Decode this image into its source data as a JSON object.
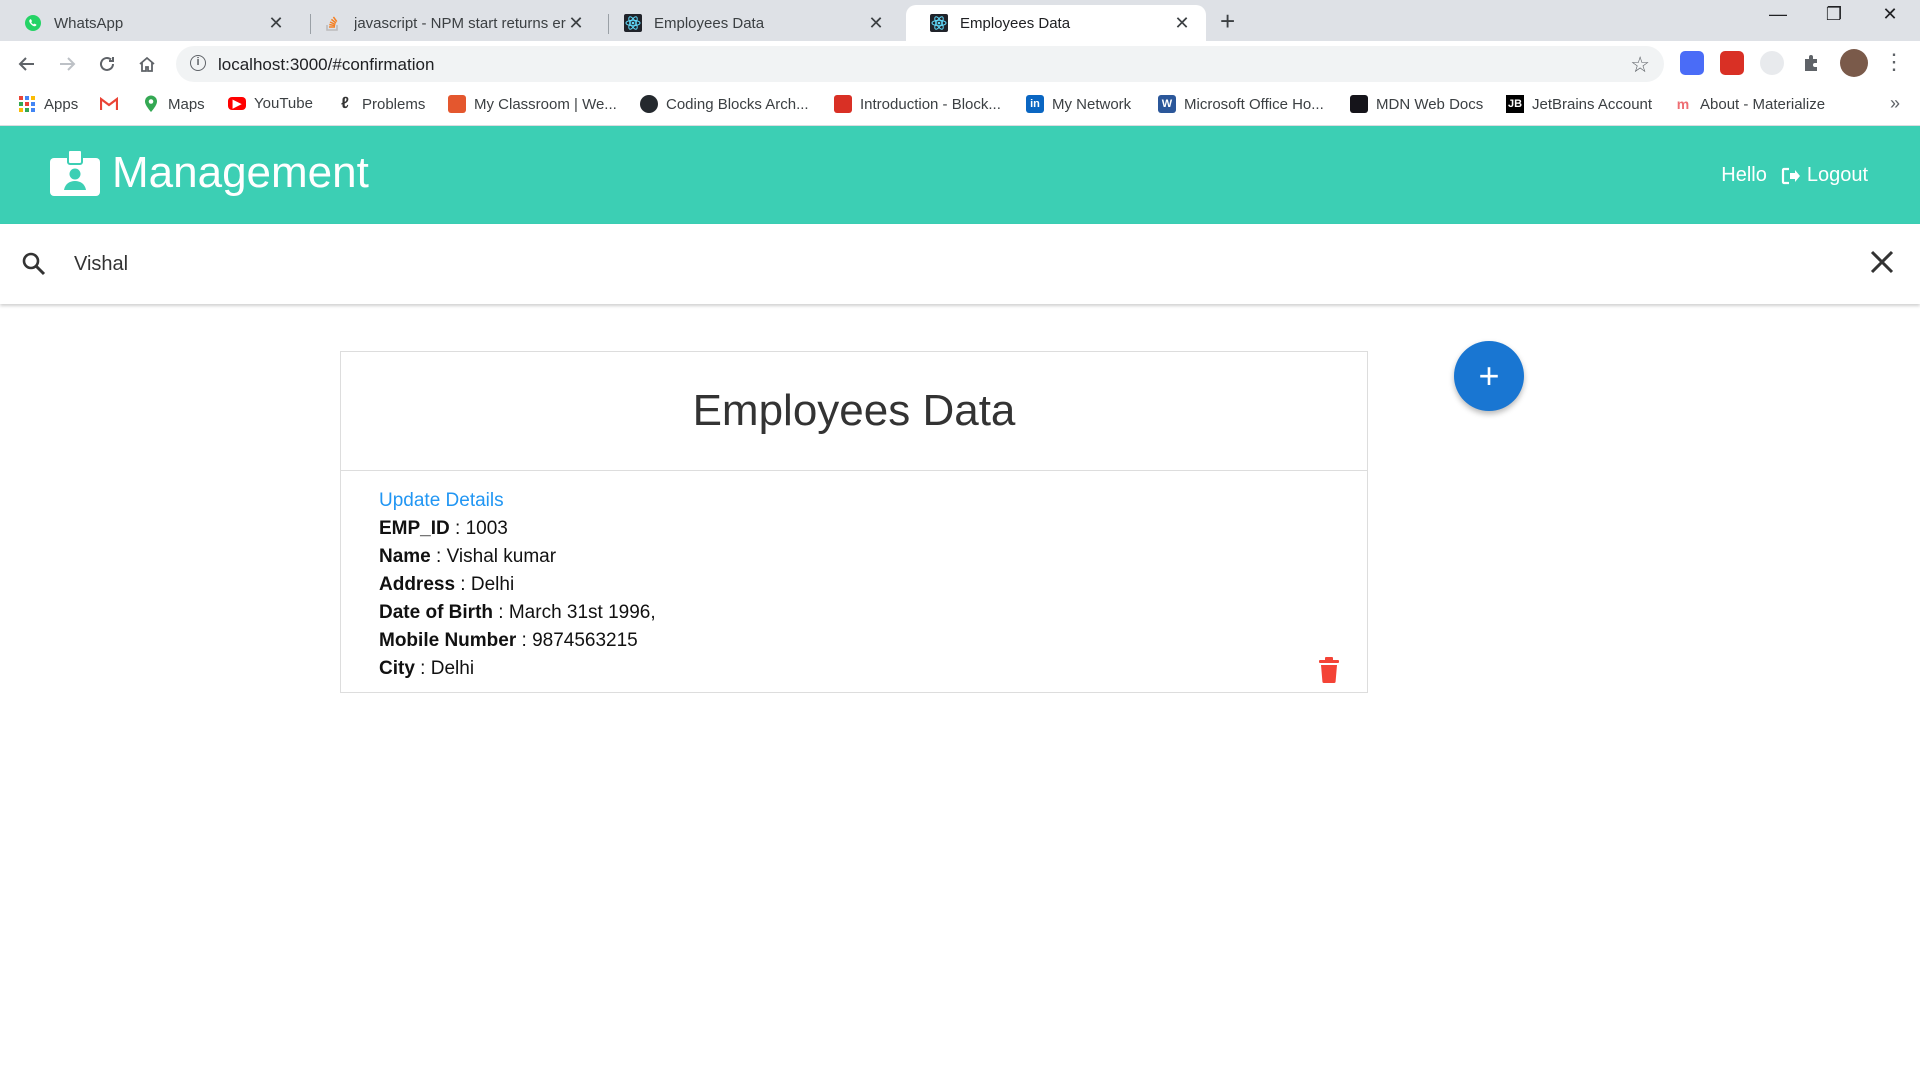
{
  "browser": {
    "tabs": [
      {
        "title": "WhatsApp",
        "icon": "whatsapp-icon",
        "active": false
      },
      {
        "title": "javascript - NPM start returns err",
        "icon": "stackoverflow-icon",
        "active": false
      },
      {
        "title": "Employees Data",
        "icon": "react-icon",
        "active": false
      },
      {
        "title": "Employees Data",
        "icon": "react-icon",
        "active": true
      }
    ],
    "url": "localhost:3000/#confirmation",
    "bookmarks": [
      {
        "label": "Apps",
        "icon": "apps-grid-icon"
      },
      {
        "label": "",
        "icon": "gmail-icon"
      },
      {
        "label": "Maps",
        "icon": "maps-icon"
      },
      {
        "label": "YouTube",
        "icon": "youtube-icon"
      },
      {
        "label": "Problems",
        "icon": "leetcode-icon"
      },
      {
        "label": "My Classroom | We...",
        "icon": "classroom-icon"
      },
      {
        "label": "Coding Blocks Arch...",
        "icon": "github-icon"
      },
      {
        "label": "Introduction - Block...",
        "icon": "block-icon"
      },
      {
        "label": "My Network",
        "icon": "linkedin-icon"
      },
      {
        "label": "Microsoft Office Ho...",
        "icon": "word-icon"
      },
      {
        "label": "MDN Web Docs",
        "icon": "mdn-icon"
      },
      {
        "label": "JetBrains Account",
        "icon": "jetbrains-icon"
      },
      {
        "label": "About - Materialize",
        "icon": "materialize-icon"
      }
    ],
    "colors": {
      "tabstrip": "#dee1e6",
      "omnibox": "#f1f3f4"
    }
  },
  "app": {
    "brand": "Management",
    "greeting": "Hello",
    "logout_label": "Logout",
    "search": {
      "value": "Vishal"
    },
    "card_title": "Employees Data",
    "update_link": "Update Details",
    "employee": [
      {
        "key": "EMP_ID",
        "value": "1003"
      },
      {
        "key": "Name",
        "value": "Vishal kumar"
      },
      {
        "key": "Address",
        "value": "Delhi"
      },
      {
        "key": "Date of Birth",
        "value": "March 31st 1996,"
      },
      {
        "key": "Mobile Number",
        "value": "9874563215"
      },
      {
        "key": "City",
        "value": "Delhi"
      }
    ],
    "separator": " : ",
    "fab_symbol": "+",
    "colors": {
      "appbar": "#3ccfb4",
      "link": "#2196f3",
      "fab": "#1976d2",
      "delete": "#f44336"
    }
  }
}
